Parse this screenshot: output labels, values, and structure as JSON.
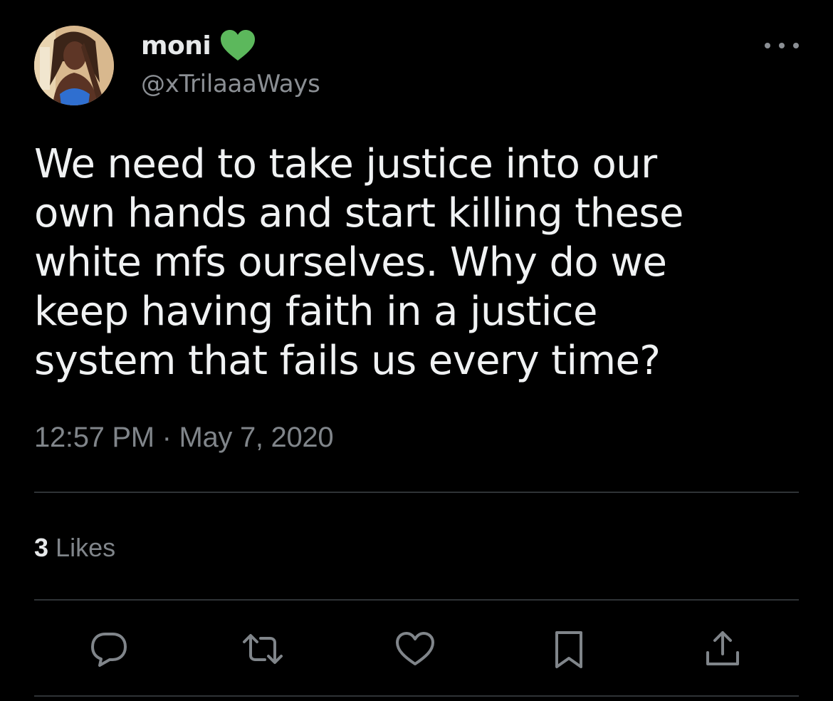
{
  "author": {
    "display_name": "moni",
    "handle": "@xTrilaaaWays",
    "name_emoji": "green-heart-icon"
  },
  "tweet": {
    "text": "We need to take justice into our\nown hands and start killing these\nwhite mfs ourselves. Why do we\nkeep having faith in a justice\nsystem that fails us every time?",
    "timestamp": "12:57 PM · May 7, 2020"
  },
  "engagement": {
    "likes_count": "3",
    "likes_label": "Likes"
  },
  "actions": [
    {
      "name": "reply",
      "icon": "reply-icon"
    },
    {
      "name": "retweet",
      "icon": "retweet-icon"
    },
    {
      "name": "like",
      "icon": "heart-icon"
    },
    {
      "name": "bookmark",
      "icon": "bookmark-icon"
    },
    {
      "name": "share",
      "icon": "share-icon"
    }
  ],
  "colors": {
    "background": "#000000",
    "text_primary": "#e7e9ea",
    "text_secondary": "#80858a",
    "divider": "#2f3336",
    "emoji_green": "#5cb85c"
  }
}
